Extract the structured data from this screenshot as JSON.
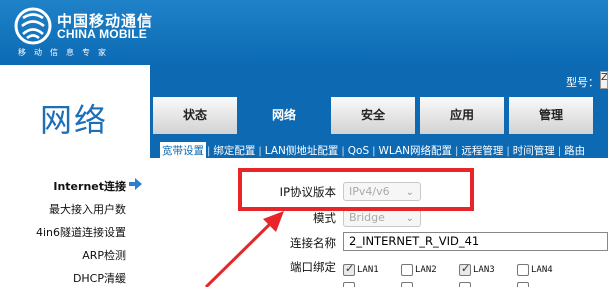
{
  "header": {
    "brand_cn": "中国移动通信",
    "brand_en": "CHINA MOBILE",
    "slogan": "移动信息专家",
    "model_label": "型号：",
    "model_value": "Z"
  },
  "section_title": "网络",
  "main_tabs": [
    {
      "label": "状态"
    },
    {
      "label": "网络"
    },
    {
      "label": "安全"
    },
    {
      "label": "应用"
    },
    {
      "label": "管理"
    }
  ],
  "sub_tabs": [
    {
      "label": "宽带设置"
    },
    {
      "label": "绑定配置"
    },
    {
      "label": "LAN侧地址配置"
    },
    {
      "label": "QoS"
    },
    {
      "label": "WLAN网络配置"
    },
    {
      "label": "远程管理"
    },
    {
      "label": "时间管理"
    },
    {
      "label": "路由"
    }
  ],
  "left_menu": [
    {
      "label": "Internet连接"
    },
    {
      "label": "最大接入用户数"
    },
    {
      "label": "4in6隧道连接设置"
    },
    {
      "label": "ARP检测"
    },
    {
      "label": "DHCP清缓"
    }
  ],
  "form": {
    "ip_version_label": "IP协议版本",
    "ip_version_value": "IPv4/v6",
    "mode_label": "模式",
    "mode_value": "Bridge",
    "conn_name_label": "连接名称",
    "conn_name_value": "2_INTERNET_R_VID_41",
    "port_binding_label": "端口绑定",
    "lan_ports": [
      {
        "label": "LAN1",
        "checked": true
      },
      {
        "label": "LAN2",
        "checked": false
      },
      {
        "label": "LAN3",
        "checked": true
      },
      {
        "label": "LAN4",
        "checked": false
      }
    ]
  },
  "colors": {
    "brand_blue": "#0e69b3",
    "annotation_red": "#e8262a"
  },
  "icons": {
    "left_menu_arrow": "arrow-right-icon",
    "select_chevron": "chevron-down-icon"
  }
}
